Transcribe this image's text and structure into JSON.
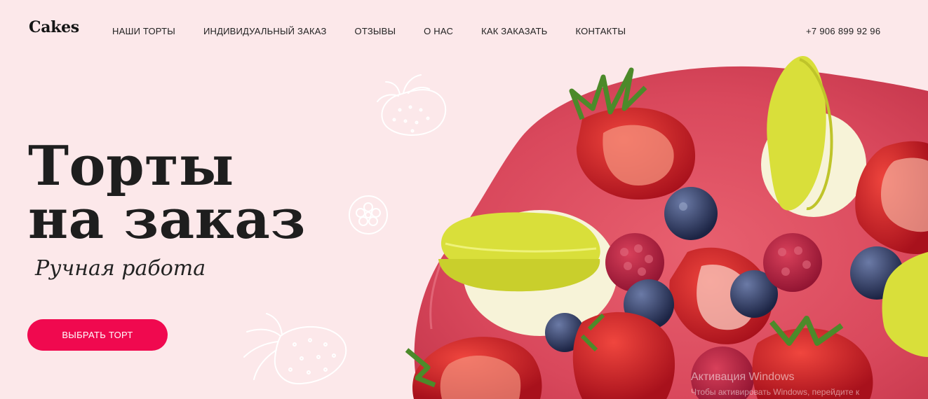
{
  "header": {
    "logo": "Cakes",
    "nav": [
      {
        "label": "НАШИ ТОРТЫ"
      },
      {
        "label": "ИНДИВИДУАЛЬНЫЙ ЗАКАЗ"
      },
      {
        "label": "ОТЗЫВЫ"
      },
      {
        "label": "О НАС"
      },
      {
        "label": "КАК ЗАКАЗАТЬ"
      },
      {
        "label": "КОНТАКТЫ"
      }
    ],
    "phone": "+7 906 899 92 96"
  },
  "hero": {
    "title_line1": "Торты",
    "title_line2": "на заказ",
    "subtitle": "Ручная работа",
    "cta_label": "ВЫБРАТЬ ТОРТ"
  },
  "overlay": {
    "activation_title": "Активация Windows",
    "activation_text": "Чтобы активировать Windows, перейдите к"
  },
  "colors": {
    "background": "#fce8ea",
    "accent": "#f0094f",
    "glaze": "#e0566b"
  }
}
